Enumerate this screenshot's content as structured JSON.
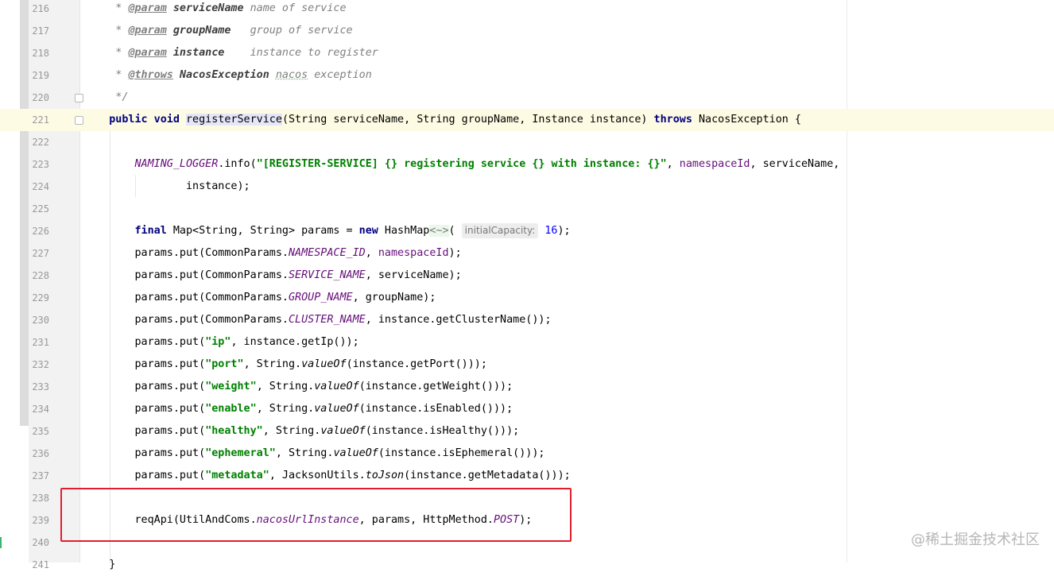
{
  "editor": {
    "lines": [
      {
        "n": "216",
        "segments": [
          {
            "t": "     * ",
            "c": "cm"
          },
          {
            "t": "@param",
            "c": "tag"
          },
          {
            "t": " ",
            "c": "cm"
          },
          {
            "t": "serviceName",
            "c": "pn"
          },
          {
            "t": " name of service",
            "c": "cm"
          }
        ]
      },
      {
        "n": "217",
        "segments": [
          {
            "t": "     * ",
            "c": "cm"
          },
          {
            "t": "@param",
            "c": "tag"
          },
          {
            "t": " ",
            "c": "cm"
          },
          {
            "t": "groupName",
            "c": "pn"
          },
          {
            "t": "   group of service",
            "c": "cm"
          }
        ]
      },
      {
        "n": "218",
        "segments": [
          {
            "t": "     * ",
            "c": "cm"
          },
          {
            "t": "@param",
            "c": "tag"
          },
          {
            "t": " ",
            "c": "cm"
          },
          {
            "t": "instance",
            "c": "pn"
          },
          {
            "t": "    instance to register",
            "c": "cm"
          }
        ]
      },
      {
        "n": "219",
        "segments": [
          {
            "t": "     * ",
            "c": "cm"
          },
          {
            "t": "@throws",
            "c": "tag"
          },
          {
            "t": " ",
            "c": "cm"
          },
          {
            "t": "NacosException",
            "c": "pn"
          },
          {
            "t": " ",
            "c": "cm"
          },
          {
            "t": "nacos",
            "c": "cm underline-wavy"
          },
          {
            "t": " exception",
            "c": "cm"
          }
        ]
      },
      {
        "n": "220",
        "segments": [
          {
            "t": "     */",
            "c": "cm"
          }
        ]
      },
      {
        "n": "221",
        "current": true,
        "segments": [
          {
            "t": "    public void ",
            "c": "kw"
          },
          {
            "t": "registerService",
            "c": "meth-hl"
          },
          {
            "t": "(String serviceName, String groupName, Instance instance) ",
            "c": ""
          },
          {
            "t": "throws",
            "c": "kw"
          },
          {
            "t": " NacosException {",
            "c": ""
          }
        ]
      },
      {
        "n": "222",
        "segments": []
      },
      {
        "n": "223",
        "segments": [
          {
            "t": "        ",
            "c": ""
          },
          {
            "t": "NAMING_LOGGER",
            "c": "cst"
          },
          {
            "t": ".info(",
            "c": ""
          },
          {
            "t": "\"[REGISTER-SERVICE] {} registering service {} with instance: {}\"",
            "c": "str"
          },
          {
            "t": ", ",
            "c": ""
          },
          {
            "t": "namespaceId",
            "c": "fld"
          },
          {
            "t": ", serviceName,",
            "c": ""
          }
        ]
      },
      {
        "n": "224",
        "segments": [
          {
            "t": "                instance);",
            "c": ""
          }
        ]
      },
      {
        "n": "225",
        "segments": []
      },
      {
        "n": "226",
        "segments": [
          {
            "t": "        ",
            "c": ""
          },
          {
            "t": "final",
            "c": "kw"
          },
          {
            "t": " Map<String, String> params = ",
            "c": ""
          },
          {
            "t": "new",
            "c": "kw"
          },
          {
            "t": " HashMap",
            "c": ""
          },
          {
            "t": "<~>",
            "c": "diamond"
          },
          {
            "t": "( ",
            "c": ""
          },
          {
            "t": "initialCapacity:",
            "c": "hint"
          },
          {
            "t": " ",
            "c": ""
          },
          {
            "t": "16",
            "c": "num"
          },
          {
            "t": ");",
            "c": ""
          }
        ]
      },
      {
        "n": "227",
        "segments": [
          {
            "t": "        params.put(CommonParams.",
            "c": ""
          },
          {
            "t": "NAMESPACE_ID",
            "c": "cst"
          },
          {
            "t": ", ",
            "c": ""
          },
          {
            "t": "namespaceId",
            "c": "fld"
          },
          {
            "t": ");",
            "c": ""
          }
        ]
      },
      {
        "n": "228",
        "segments": [
          {
            "t": "        params.put(CommonParams.",
            "c": ""
          },
          {
            "t": "SERVICE_NAME",
            "c": "cst"
          },
          {
            "t": ", serviceName);",
            "c": ""
          }
        ]
      },
      {
        "n": "229",
        "segments": [
          {
            "t": "        params.put(CommonParams.",
            "c": ""
          },
          {
            "t": "GROUP_NAME",
            "c": "cst"
          },
          {
            "t": ", groupName);",
            "c": ""
          }
        ]
      },
      {
        "n": "230",
        "segments": [
          {
            "t": "        params.put(CommonParams.",
            "c": ""
          },
          {
            "t": "CLUSTER_NAME",
            "c": "cst"
          },
          {
            "t": ", instance.getClusterName());",
            "c": ""
          }
        ]
      },
      {
        "n": "231",
        "segments": [
          {
            "t": "        params.put(",
            "c": ""
          },
          {
            "t": "\"ip\"",
            "c": "str"
          },
          {
            "t": ", instance.getIp());",
            "c": ""
          }
        ]
      },
      {
        "n": "232",
        "segments": [
          {
            "t": "        params.put(",
            "c": ""
          },
          {
            "t": "\"port\"",
            "c": "str"
          },
          {
            "t": ", String.",
            "c": ""
          },
          {
            "t": "valueOf",
            "c": "sti"
          },
          {
            "t": "(instance.getPort()));",
            "c": ""
          }
        ]
      },
      {
        "n": "233",
        "segments": [
          {
            "t": "        params.put(",
            "c": ""
          },
          {
            "t": "\"weight\"",
            "c": "str"
          },
          {
            "t": ", String.",
            "c": ""
          },
          {
            "t": "valueOf",
            "c": "sti"
          },
          {
            "t": "(instance.getWeight()));",
            "c": ""
          }
        ]
      },
      {
        "n": "234",
        "segments": [
          {
            "t": "        params.put(",
            "c": ""
          },
          {
            "t": "\"enable\"",
            "c": "str"
          },
          {
            "t": ", String.",
            "c": ""
          },
          {
            "t": "valueOf",
            "c": "sti"
          },
          {
            "t": "(instance.isEnabled()));",
            "c": ""
          }
        ]
      },
      {
        "n": "235",
        "segments": [
          {
            "t": "        params.put(",
            "c": ""
          },
          {
            "t": "\"healthy\"",
            "c": "str"
          },
          {
            "t": ", String.",
            "c": ""
          },
          {
            "t": "valueOf",
            "c": "sti"
          },
          {
            "t": "(instance.isHealthy()));",
            "c": ""
          }
        ]
      },
      {
        "n": "236",
        "segments": [
          {
            "t": "        params.put(",
            "c": ""
          },
          {
            "t": "\"ephemeral\"",
            "c": "str"
          },
          {
            "t": ", String.",
            "c": ""
          },
          {
            "t": "valueOf",
            "c": "sti"
          },
          {
            "t": "(instance.isEphemeral()));",
            "c": ""
          }
        ]
      },
      {
        "n": "237",
        "segments": [
          {
            "t": "        params.put(",
            "c": ""
          },
          {
            "t": "\"metadata\"",
            "c": "str"
          },
          {
            "t": ", JacksonUtils.",
            "c": ""
          },
          {
            "t": "toJson",
            "c": "sti"
          },
          {
            "t": "(instance.getMetadata()));",
            "c": ""
          }
        ]
      },
      {
        "n": "238",
        "segments": []
      },
      {
        "n": "239",
        "segments": [
          {
            "t": "        reqApi(UtilAndComs.",
            "c": ""
          },
          {
            "t": "nacosUrlInstance",
            "c": "cst"
          },
          {
            "t": ", params, HttpMethod.",
            "c": ""
          },
          {
            "t": "POST",
            "c": "cst"
          },
          {
            "t": ");",
            "c": ""
          }
        ]
      },
      {
        "n": "240",
        "segments": []
      },
      {
        "n": "241",
        "segments": [
          {
            "t": "    }",
            "c": ""
          }
        ]
      }
    ]
  },
  "watermark": "@稀土掘金技术社区"
}
